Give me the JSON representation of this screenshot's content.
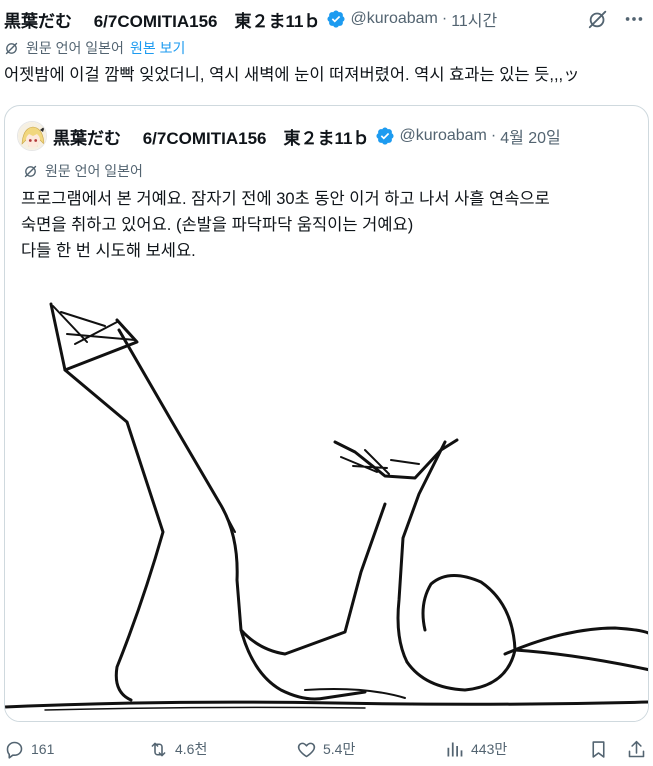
{
  "tweet": {
    "author_name": "黒葉だむ　 6/7COMITIA156　東２ま11ｂ",
    "handle": "@kuroabam",
    "separator": "·",
    "time": "11시간",
    "translation_label": "원문 언어 일본어",
    "show_original": "원본 보기",
    "text": "어젯밤에 이걸 깜빡 잊었더니, 역시 새벽에 눈이 떠져버렸어. 역시 효과는 있는 듯,,,ッ"
  },
  "quote": {
    "author_name": "黒葉だむ　 6/7COMITIA156　東２ま11ｂ",
    "handle": "@kuroabam",
    "separator": "·",
    "time": "4월 20일",
    "translation_label": "원문 언어 일본어",
    "text_lines": [
      "프로그램에서 본 거예요. 잠자기 전에 30초 동안 이거 하고 나서 사흘 연속으로",
      "숙면을 취하고 있어요. (손발을 파닥파닥 움직이는 거예요)",
      "다들 한 번 시도해 보세요."
    ]
  },
  "actions": {
    "replies": "161",
    "reposts": "4.6천",
    "likes": "5.4만",
    "views": "443만"
  },
  "icons": {
    "verified": "verified-badge-icon",
    "grok": "grok-icon",
    "more": "more-icon",
    "translate": "translate-icon",
    "reply": "reply-icon",
    "repost": "repost-icon",
    "like": "like-icon",
    "views": "views-icon",
    "bookmark": "bookmark-icon",
    "share": "share-icon"
  },
  "colors": {
    "accent": "#1d9bf0",
    "secondary_text": "#536471",
    "border": "#cfd9de"
  }
}
